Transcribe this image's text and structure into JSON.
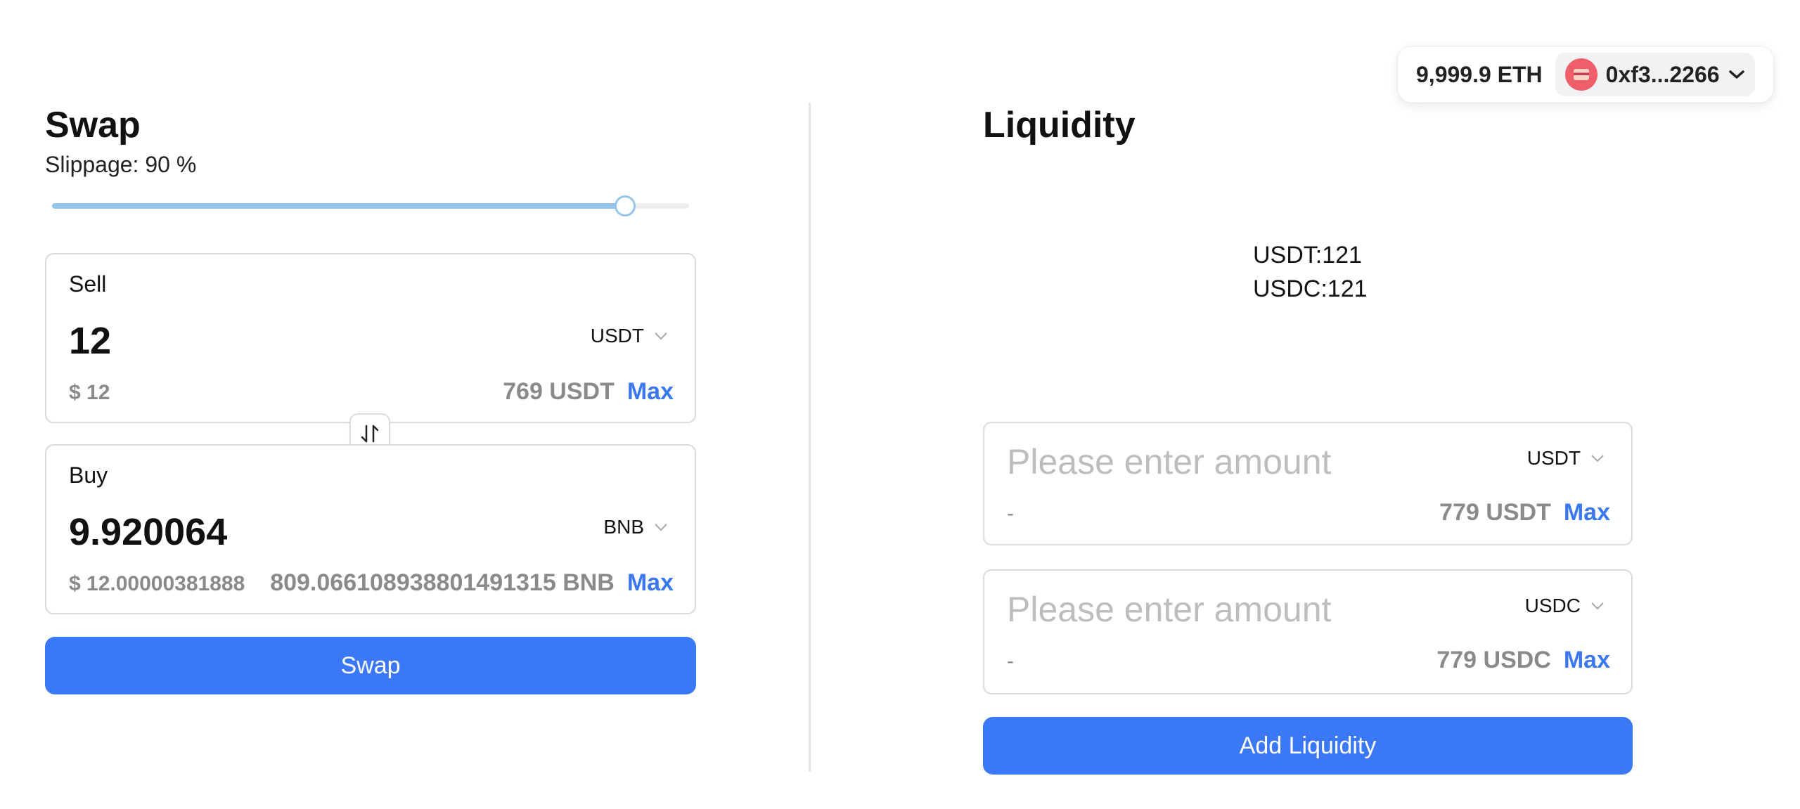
{
  "wallet": {
    "balance": "9,999.9 ETH",
    "address": "0xf3...2266",
    "avatar_icon": "wallet-icon"
  },
  "swap": {
    "title": "Swap",
    "slippage_text": "Slippage: 90 %",
    "slippage_value": 90,
    "sell": {
      "label": "Sell",
      "amount": "12",
      "token": "USDT",
      "usd_value": "$ 12",
      "balance": "769 USDT",
      "max_label": "Max"
    },
    "buy": {
      "label": "Buy",
      "amount": "9.920064",
      "token": "BNB",
      "usd_value": "$ 12.00000381888",
      "balance": "809.066108938801491315 BNB",
      "max_label": "Max"
    },
    "switch_icon": "swap-arrows-icon",
    "button_label": "Swap"
  },
  "liquidity": {
    "title": "Liquidity",
    "pool_lines": [
      "USDT:121",
      "USDC:121"
    ],
    "input_a": {
      "placeholder": "Please enter amount",
      "token": "USDT",
      "usd_value": "-",
      "balance": "779 USDT",
      "max_label": "Max"
    },
    "input_b": {
      "placeholder": "Please enter amount",
      "token": "USDC",
      "usd_value": "-",
      "balance": "779 USDC",
      "max_label": "Max"
    },
    "button_label": "Add Liquidity"
  },
  "colors": {
    "primary": "#3b78f5",
    "max_link": "#3b78f0",
    "slider": "#95c4ec",
    "muted_text": "#8a8a8a",
    "avatar": "#ef5f6a"
  }
}
